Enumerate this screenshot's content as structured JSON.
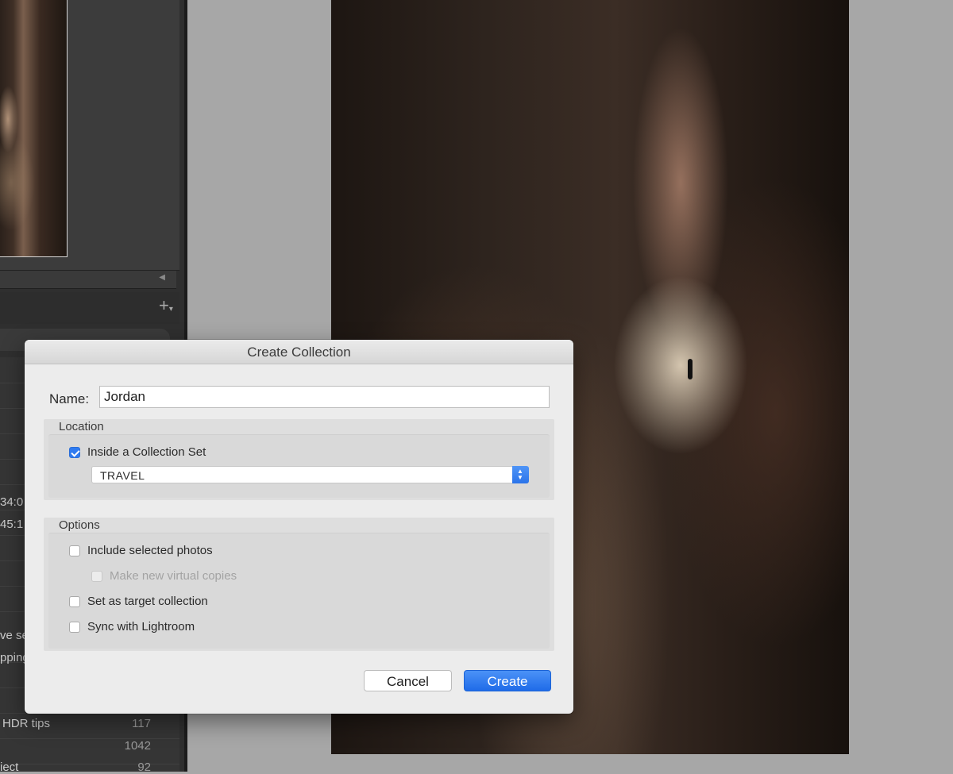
{
  "background_panel": {
    "fragments": [
      "34:0",
      "45:1",
      "ve se",
      "pping",
      "HDR tips",
      "iect"
    ],
    "counts": [
      "117",
      "1042",
      "92"
    ]
  },
  "dialog": {
    "title": "Create Collection",
    "name_label": "Name:",
    "name_value": "Jordan",
    "location": {
      "label": "Location",
      "inside_set_label": "Inside a Collection Set",
      "inside_set_checked": true,
      "set_value": "TRAVEL"
    },
    "options": {
      "label": "Options",
      "include_selected_label": "Include selected photos",
      "virtual_copies_label": "Make new virtual copies",
      "target_collection_label": "Set as target collection",
      "sync_label": "Sync with Lightroom"
    },
    "buttons": {
      "cancel": "Cancel",
      "create": "Create"
    }
  },
  "colors": {
    "accent": "#2f7bf0",
    "dialog_bg": "#ececec",
    "panel_bg": "#2f2f2f"
  },
  "icons": [
    "plus-icon",
    "checkmark-icon",
    "stepper-chevrons-icon",
    "triangle-icon"
  ]
}
